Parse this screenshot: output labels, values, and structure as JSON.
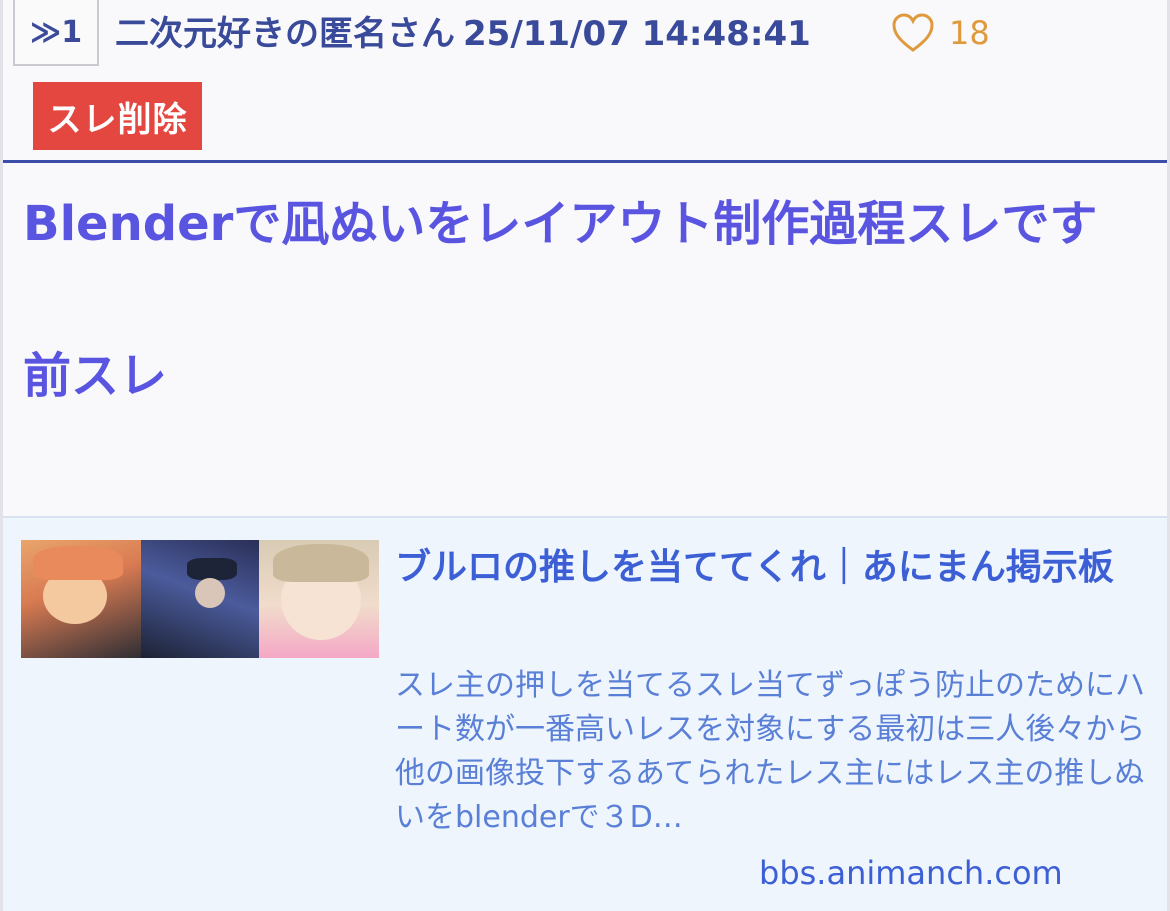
{
  "post": {
    "res_number": "≫1",
    "author": "二次元好きの匿名さん",
    "timestamp": "25/11/07 14:48:41",
    "like_count": "18",
    "delete_label": "スレ削除",
    "body_line1": "Blenderで凪ぬいをレイアウト制作過程スレです",
    "body_line2": "前スレ"
  },
  "link_card": {
    "title": "ブルロの推しを当ててくれ｜あにまん掲示板",
    "description": "スレ主の押しを当てるスレ当てずっぽう防止のためにハート数が一番高いレスを対象にする最初は三人後々から他の画像投下するあてられたレス主にはレス主の推しぬいをblenderで３D…",
    "domain": "bbs.animanch.com"
  },
  "colors": {
    "accent_blue": "#3a4a9a",
    "link_purple": "#5a55e0",
    "delete_red": "#e44740",
    "heart_orange": "#e09a3e"
  }
}
